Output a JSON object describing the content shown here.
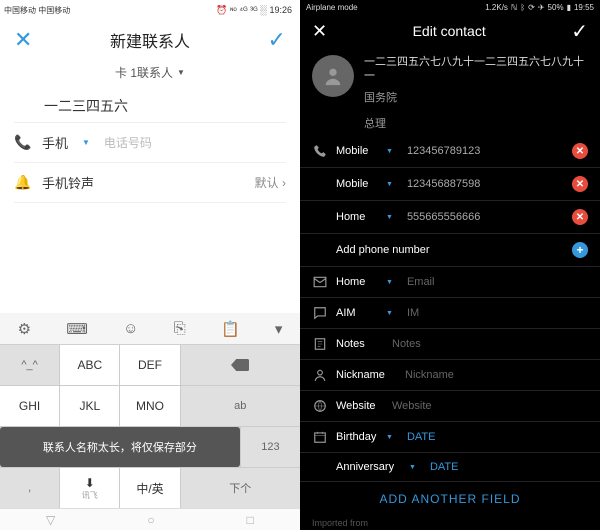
{
  "left": {
    "status": {
      "carrier": "中国移动\n中国移动",
      "time": "19:26",
      "icons": "⏰ ᶰᵒ ⁴ᴳ ³ᴳ ░"
    },
    "header": {
      "title": "新建联系人"
    },
    "subheader": {
      "text": "卡 1联系人"
    },
    "name_value": "一二三四五六",
    "phone": {
      "label": "手机",
      "placeholder": "电话号码"
    },
    "ringtone": {
      "label": "手机铃声",
      "value": "默认"
    },
    "toast": "联系人名称太长，将仅保存部分",
    "keys": {
      "r1c1": "^_^",
      "r1c2": "ABC",
      "r1c3": "DEF",
      "r2c1": "GHI",
      "r2c2": "JKL",
      "r2c3": "MNO",
      "r2c4": "ab",
      "r3c4": "123",
      "r4c1": ",",
      "r4c2": "⬇",
      "r4c3": "中/英",
      "r4c4": "下个"
    },
    "iflytek": "讯飞"
  },
  "right": {
    "status": {
      "mode": "Airplane mode",
      "speed": "1.2K/s",
      "battery": "50%",
      "time": "19:55"
    },
    "header": {
      "title": "Edit contact"
    },
    "name": "一二三四五六七八九十一二三四五六七八九十一",
    "org": "国务院",
    "title": "总理",
    "phones": [
      {
        "type": "Mobile",
        "num": "123456789123"
      },
      {
        "type": "Mobile",
        "num": "123456887598"
      },
      {
        "type": "Home",
        "num": "555665556666"
      }
    ],
    "add_phone": "Add phone number",
    "email": {
      "type": "Home",
      "ph": "Email"
    },
    "im": {
      "type": "AIM",
      "ph": "IM"
    },
    "notes": {
      "lbl": "Notes",
      "ph": "Notes"
    },
    "nickname": {
      "lbl": "Nickname",
      "ph": "Nickname"
    },
    "website": {
      "lbl": "Website",
      "ph": "Website"
    },
    "birthday": {
      "lbl": "Birthday",
      "val": "DATE"
    },
    "anniversary": {
      "lbl": "Anniversary",
      "val": "DATE"
    },
    "add_field": "ADD ANOTHER FIELD",
    "imported": "Imported from"
  }
}
